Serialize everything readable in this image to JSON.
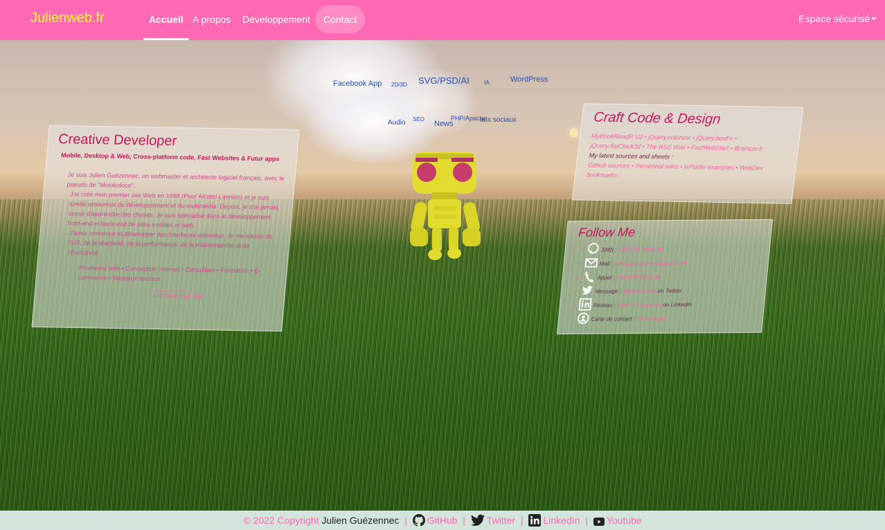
{
  "nav": {
    "brand": "Julienweb.fr",
    "items": [
      {
        "label": "Accueil"
      },
      {
        "label": "A propos"
      },
      {
        "label": "Développement"
      },
      {
        "label": "Contact"
      }
    ],
    "secure": "Espace sécurisé"
  },
  "tags": [
    "Facebook App",
    "2D/3D",
    "SVG/PSD/AI",
    "IA",
    "WordPress",
    "Audio",
    "SEO",
    "News",
    "PHP/Apache",
    "aux sociaux"
  ],
  "creative": {
    "title": "Creative Developer",
    "subtitle": "Mobile, Desktop & Web, Cross-platform code, Fast Websites & Futur apps",
    "p1": "Je suis Julien Guézennec, un webmaster et architecte logiciel français, avec le pseudo de \"Molokoloco\".",
    "p2": "J'ai créé mon premier site Web en 1998 (Pour Alcatel Lannion) et je suis tombé amoureux du développement et du multimédia. Depuis, je n'ai jamais cessé d'apprendre des choses. Je suis spécialisé dans le développement front-end et back-end de sites mobiles et web.",
    "p3": "J'aime concevoir et développer des interfaces utilisateur. Je me soucie de l'UX, de la réactivité, de la performance, de la maintenabilité et de l'évolutivité.",
    "services": "Freelance web • Conception Internet • Consultant • Formation • E-commerce • Réseaux sociaux",
    "cta": "Lire plus sur moi"
  },
  "craft": {
    "title": "Craft Code & Design",
    "line1": "MyBookReadR V2 • jQuery.colonize • jQuery.boxFx •",
    "line2": "jQuery.flatClock3d • The RSS Wall • FastWebStart • Braincer.fr",
    "line3": "My latest sources and sheets :",
    "line4": "Github sources • Personnal wikis • jsFiddle examples • WebDev bookmarks"
  },
  "follow": {
    "title": "Follow Me",
    "items": [
      {
        "icon": "sms-icon",
        "prefix": "SMS :",
        "value": "+33 6 34 75 51 90",
        "suffix": ""
      },
      {
        "icon": "mail-icon",
        "prefix": "Mail :",
        "value": "julien.guezennec@gmail.com",
        "suffix": ""
      },
      {
        "icon": "phone-icon",
        "prefix": "Appel :",
        "value": "+33 6 34 75 51 90",
        "suffix": ""
      },
      {
        "icon": "twitter-icon",
        "prefix": "Message :",
        "value": "@molokoloco",
        "suffix": "on Twitter"
      },
      {
        "icon": "linkedin-icon",
        "prefix": "Réseau :",
        "value": "Julien Guézennec",
        "suffix": "on LinkedIn"
      },
      {
        "icon": "vcard-icon",
        "prefix": "Carte de contact :",
        "value": "Télécharger",
        "suffix": ""
      }
    ]
  },
  "footer": {
    "copyright": "© 2022 Copyright",
    "author": "Julien Guézennec",
    "github": "GitHub",
    "twitter": "Twitter",
    "linkedin": "LinkedIn",
    "youtube": "Youtube",
    "separator": "|"
  },
  "colors": {
    "navbar": "#ff69b4",
    "brand": "#ffff33",
    "footer_bg": "#d4e6dc",
    "accent": "#c2185b"
  }
}
